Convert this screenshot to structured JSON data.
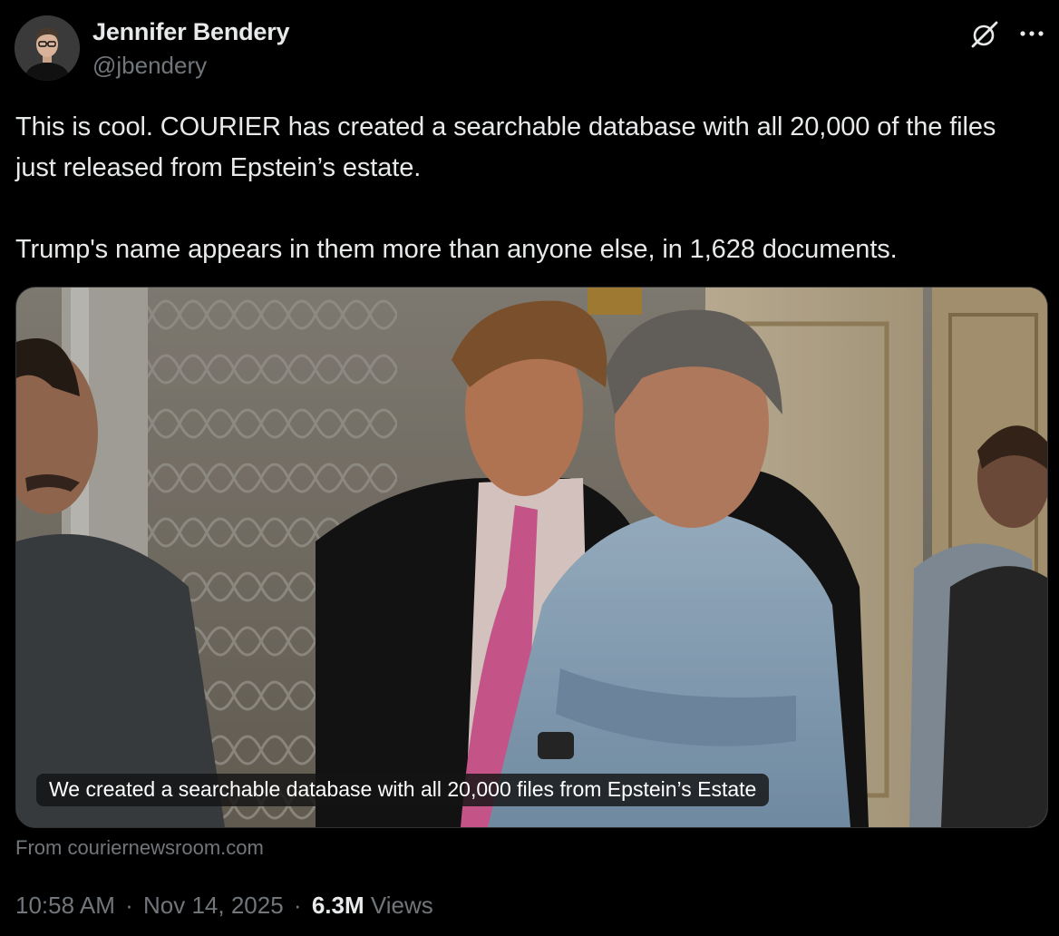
{
  "author": {
    "name": "Jennifer Bendery",
    "handle": "@jbendery"
  },
  "tweet": {
    "paragraph_1": "This is cool. COURIER has created a searchable database with all 20,000 of the files just released from Epstein’s estate.",
    "paragraph_2": "Trump's name appears in them more than anyone else, in 1,628 documents."
  },
  "card": {
    "caption": "We created a searchable database with all 20,000 files from Epstein’s Estate",
    "source": "From couriernewsroom.com"
  },
  "meta": {
    "time": "10:58 AM",
    "separator": "·",
    "date": "Nov 14, 2025",
    "views_count": "6.3M",
    "views_label": "Views"
  },
  "icons": {
    "grok": "grok-icon",
    "more": "more-icon"
  },
  "colors": {
    "background": "#000000",
    "text_primary": "#e7e9ea",
    "text_secondary": "#71767b"
  }
}
